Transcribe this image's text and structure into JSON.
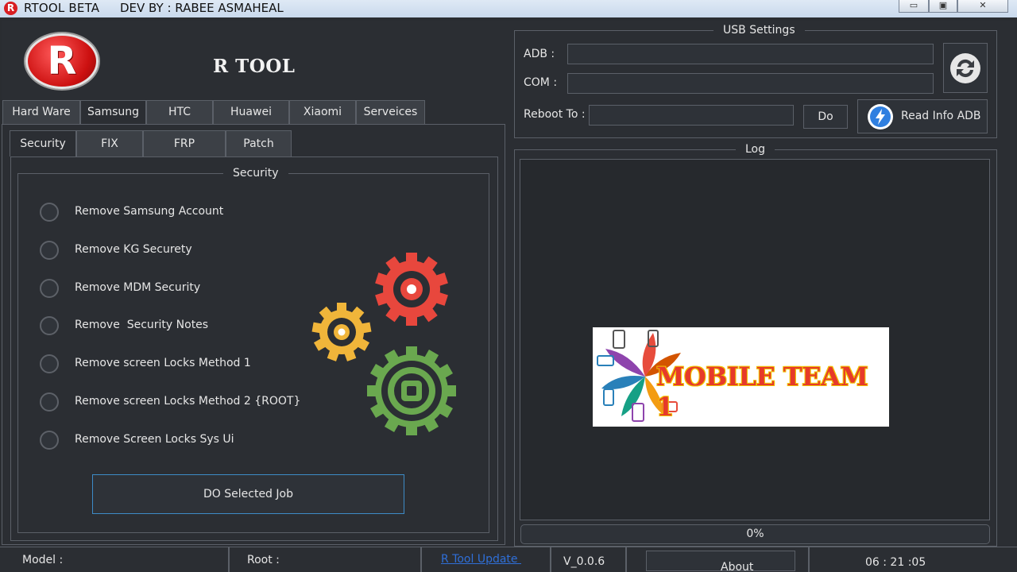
{
  "window": {
    "title": "RTOOL  BETA",
    "developer": "DEV BY : RABEE ASMAHEAL",
    "icon_letter": "R",
    "controls": {
      "minimize": "▭",
      "maximize": "▣",
      "close": "✕"
    }
  },
  "logo": {
    "letter": "R"
  },
  "app_title": "R TOOL",
  "main_tabs": [
    "Hard Ware",
    "Samsung",
    "HTC",
    "Huawei",
    "Xiaomi",
    "Serveices"
  ],
  "sub_tabs": [
    "Security",
    "FIX",
    "FRP",
    "Patch"
  ],
  "security_group": {
    "legend": "Security",
    "options": [
      "Remove Samsung Account",
      "Remove KG Securety",
      "Remove MDM Security",
      "Remove  Security Notes",
      "Remove screen Locks Method 1",
      "Remove screen Locks Method 2 {ROOT}",
      "Remove Screen Locks Sys Ui"
    ],
    "run_button": "DO Selected Job"
  },
  "usb_settings": {
    "legend": "USB Settings",
    "adb_label": "ADB :",
    "com_label": "COM :",
    "reboot_label": "Reboot To :",
    "do_button": "Do",
    "read_info_button": "Read Info ADB",
    "refresh_icon": "refresh-icon"
  },
  "log": {
    "legend": "Log"
  },
  "watermark": {
    "text": "MOBILE TEAM 1"
  },
  "progress": {
    "value": 0,
    "label": "0%"
  },
  "status_bar": {
    "model_label": "Model :",
    "root_label": "Root :",
    "update_link": "R Tool Update ",
    "version": "V_0.0.6",
    "about_button": "About",
    "time": "06 : 21 :05"
  },
  "colors": {
    "background": "#2b2e33",
    "border": "#5b6068",
    "accent_blue": "#3d8bc7",
    "gear_red": "#e8473d",
    "gear_yellow": "#f0b53a",
    "gear_green": "#6aa84f",
    "logo_red": "#cc1010"
  }
}
